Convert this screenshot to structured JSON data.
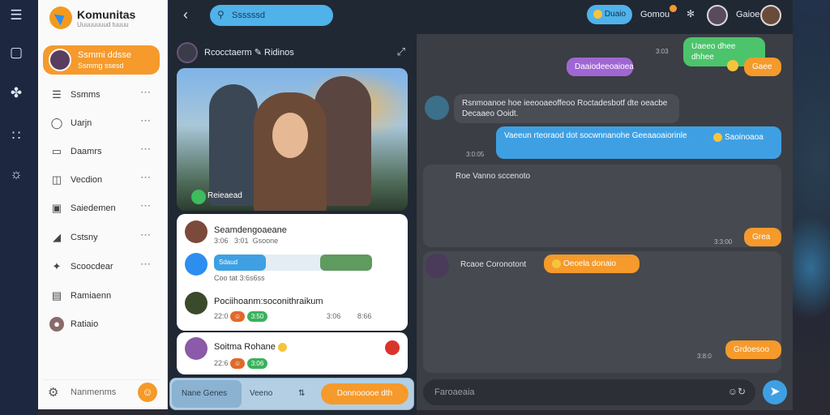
{
  "app": {
    "brand": "Komunitas",
    "brand_sub": "Uuuuuuuud tuuuu"
  },
  "rail": {
    "icons": [
      "menu-icon",
      "window-icon",
      "feather-icon",
      "grid-icon",
      "compass-icon"
    ]
  },
  "search": {
    "placeholder": "Ssssssd"
  },
  "profile": {
    "name": "Ssmmi ddsse",
    "status": "Ssmmg ssesd"
  },
  "sidebar": {
    "items": [
      {
        "label": "Ssmms",
        "icon": "list-icon"
      },
      {
        "label": "Uarjn",
        "icon": "message-circle-icon"
      },
      {
        "label": "Daamrs",
        "icon": "chat-icon"
      },
      {
        "label": "Vecdion",
        "icon": "layout-icon"
      },
      {
        "label": "Saiedemen",
        "icon": "image-icon"
      },
      {
        "label": "Cstsny",
        "icon": "megaphone-icon"
      },
      {
        "label": "Scoocdear",
        "icon": "pin-icon"
      },
      {
        "label": "Ramiaenn",
        "icon": "calendar-icon"
      },
      {
        "label": "Ratiaio",
        "icon": "user-avatar-icon"
      }
    ],
    "footer_label": "Nanmenms"
  },
  "post": {
    "author": "Rcocctaerm",
    "tag": "Ridinos",
    "caption": "Reieaead"
  },
  "comments": [
    {
      "name": "Seamdengoaeane",
      "time": "3:06",
      "count": "3:01",
      "sub": "Gsoone"
    },
    {
      "name": "",
      "progress": 0.33,
      "progress_label": "Sdaud",
      "meta": "Coo   tat  3:6s6ss"
    },
    {
      "name": "Pociihoanm:soconithraikum",
      "time": "22:0",
      "count": "3:50",
      "r1": "3:06",
      "r2": "8:66"
    },
    {
      "name": "Soitma Rohane",
      "time": "22:6",
      "count": "3:06"
    }
  ],
  "bottom_tabs": {
    "primary": "Nane Genes",
    "secondary": "Veeno",
    "cta": "Donnooooe dth"
  },
  "topbar": {
    "badge": "Duaio",
    "name1": "Gomou",
    "name2": "Gaioe"
  },
  "chat": {
    "messages": [
      {
        "side": "right",
        "text": "Uaeeo dhee dhhee",
        "time": "3:03",
        "color": "#4cc46b"
      },
      {
        "side": "right",
        "text": "Daaiodeeoaioea",
        "time": "",
        "color": "#a067d4"
      },
      {
        "side": "right",
        "text": "Gaee",
        "time": "",
        "color": "#f59a2b"
      },
      {
        "side": "left",
        "text": "Rsnmoanoe hoe ieeooaeoffeoo Roctadesbotf dte oeacbe Decaaeo Ooidt.",
        "time": "",
        "color": "#4a4d53"
      },
      {
        "side": "right",
        "text": "Vaeeun rteoraod dot socwnnanohe Geeaaoaiorinle",
        "time": "3:0:05",
        "color": "#3ea0e3",
        "extra": "Saoinoaoa"
      },
      {
        "side": "left",
        "text": "Roe Vanno sccenoto",
        "time": "3:3:00",
        "color": ""
      },
      {
        "side": "right",
        "text": "Grea",
        "time": "",
        "color": "#f59a2b"
      },
      {
        "side": "left",
        "text": "Rcaoe Coronotont",
        "time": "",
        "color": "",
        "reply": "Oeoela donaio"
      },
      {
        "side": "right",
        "text": "Grdoesoo",
        "time": "3:8:0",
        "color": "#f59a2b"
      }
    ],
    "input_placeholder": "Faroaeaia"
  }
}
